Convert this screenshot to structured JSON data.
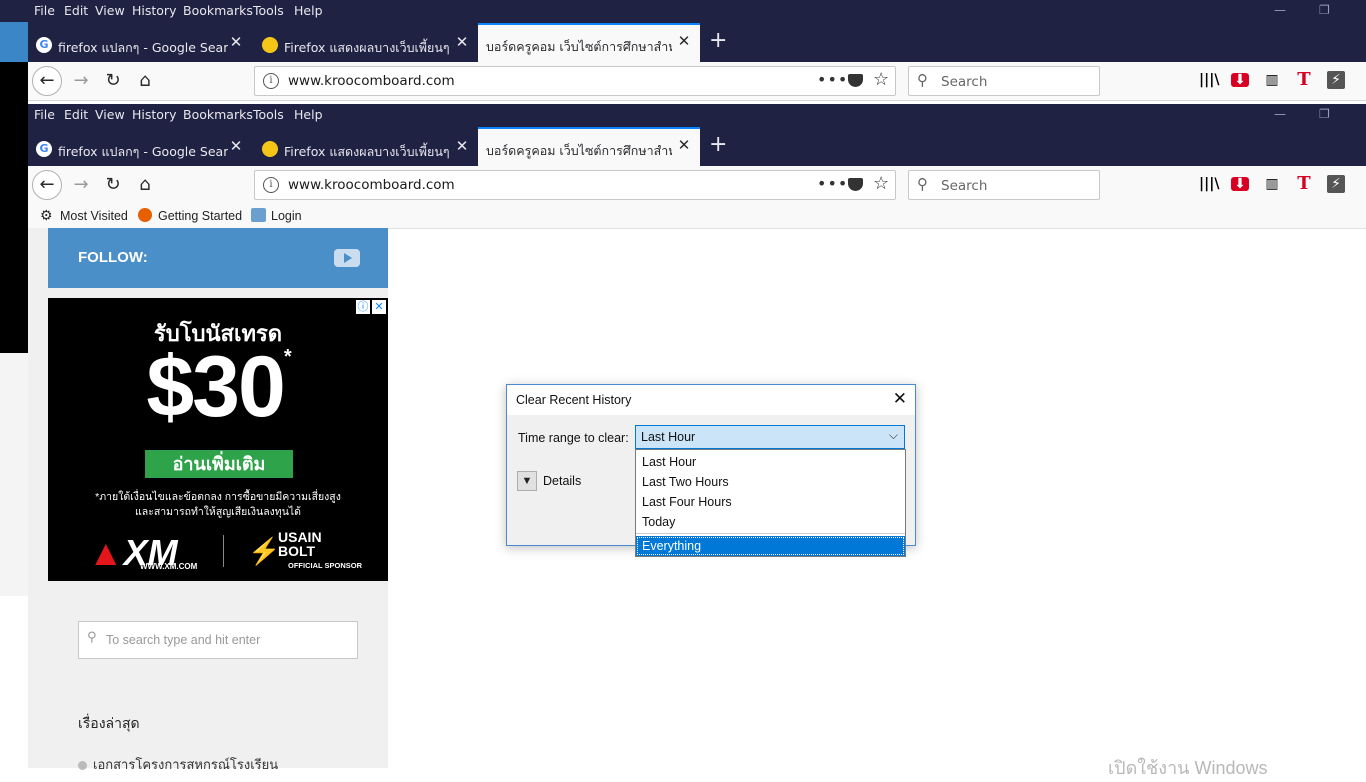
{
  "menu": [
    "File",
    "Edit",
    "View",
    "History",
    "Bookmarks",
    "Tools",
    "Help"
  ],
  "window_controls": {
    "minimize": "—",
    "restore": "❐"
  },
  "tabs": [
    {
      "label": "firefox แปลกๆ - Google Search",
      "favicon": "google-icon"
    },
    {
      "label": "Firefox แสดงผลบางเว็บเพี้ยนๆ พื้นหลัง",
      "favicon": "emoji-icon"
    },
    {
      "label": "บอร์ดครูคอม เว็บไซต์การศึกษาสำหรับครูคอม",
      "favicon": "none",
      "active": true
    }
  ],
  "nav": {
    "back": "←",
    "forward": "→",
    "reload": "↻",
    "home": "⌂"
  },
  "url": "www.kroocomboard.com",
  "url_actions": {
    "more": "•••"
  },
  "search_placeholder": "Search",
  "bookmarks": [
    "Most Visited",
    "Getting Started",
    "Login"
  ],
  "page": {
    "follow": "FOLLOW:",
    "ad": {
      "headline": "รับโบนัสเทรด",
      "amount": "$30",
      "amount_mark": "*",
      "cta": "อ่านเพิ่มเติม",
      "disclaimer_1": "*ภายใต้เงื่อนไขและข้อตกลง การซื้อขายมีความเสี่ยงสูง",
      "disclaimer_2": "และสามารถทำให้สูญเสียเงินลงทุนได้",
      "brand": "XM",
      "brand_site": "WWW.XM.COM",
      "partner": "USAIN BOLT",
      "partner_role": "OFFICIAL SPONSOR",
      "adchoices": "ⓘ",
      "close": "✕"
    },
    "search_placeholder": "To search type and hit enter",
    "recent_heading": "เรื่องล่าสุด",
    "recent_item": "เอกสารโครงการสหกรณ์โรงเรียน"
  },
  "dialog": {
    "title": "Clear Recent History",
    "close": "✕",
    "time_range_label": "Time range to clear:",
    "selected": "Last Hour",
    "details_label": "Details",
    "options": [
      "Last Hour",
      "Last Two Hours",
      "Last Four Hours",
      "Today",
      "Everything"
    ],
    "highlighted_option": "Everything"
  },
  "watermark": "เปิดใช้งาน Windows",
  "colors": {
    "chrome_dark": "#1f2242",
    "accent_blue": "#0a84ff",
    "follow_bar": "#4a8fc7",
    "selection": "#0078d7"
  }
}
